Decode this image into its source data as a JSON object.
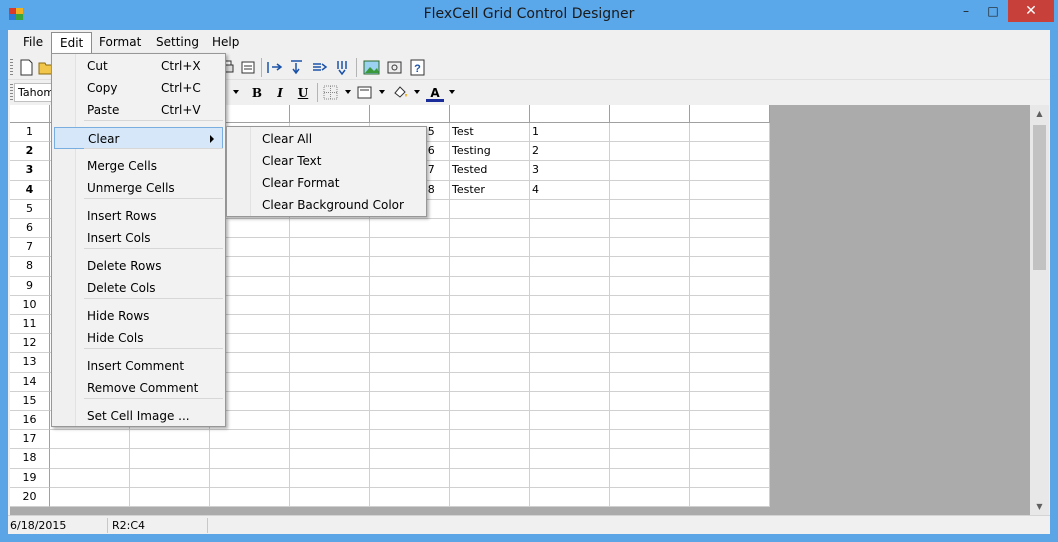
{
  "window": {
    "title": "FlexCell Grid Control Designer",
    "minimize": "–",
    "maximize": "□",
    "close": "✕"
  },
  "menubar": [
    "File",
    "Edit",
    "Format",
    "Setting",
    "Help"
  ],
  "toolbar": {
    "font": "Tahoma",
    "bold": "B",
    "italic": "I",
    "underline": "U",
    "font_color_glyph": "A"
  },
  "edit_menu": {
    "items": [
      {
        "label": "Cut",
        "shortcut": "Ctrl+X"
      },
      {
        "label": "Copy",
        "shortcut": "Ctrl+C"
      },
      {
        "label": "Paste",
        "shortcut": "Ctrl+V"
      },
      {
        "label": "Clear",
        "shortcut": ""
      },
      {
        "label": "Merge Cells",
        "shortcut": ""
      },
      {
        "label": "Unmerge Cells",
        "shortcut": ""
      },
      {
        "label": "Insert Rows",
        "shortcut": ""
      },
      {
        "label": "Insert Cols",
        "shortcut": ""
      },
      {
        "label": "Delete Rows",
        "shortcut": ""
      },
      {
        "label": "Delete Cols",
        "shortcut": ""
      },
      {
        "label": "Hide Rows",
        "shortcut": ""
      },
      {
        "label": "Hide Cols",
        "shortcut": ""
      },
      {
        "label": "Insert Comment",
        "shortcut": ""
      },
      {
        "label": "Remove Comment",
        "shortcut": ""
      },
      {
        "label": "Set Cell Image ...",
        "shortcut": ""
      }
    ]
  },
  "clear_submenu": [
    "Clear All",
    "Clear Text",
    "Clear Format",
    "Clear Background Color"
  ],
  "grid": {
    "row_numbers": [
      "1",
      "2",
      "3",
      "4",
      "5",
      "6",
      "7",
      "8",
      "9",
      "10",
      "11",
      "12",
      "13",
      "14",
      "15",
      "16",
      "17",
      "18",
      "19",
      "20"
    ],
    "bold_rows": [
      "2",
      "3",
      "4"
    ],
    "visible_cells": [
      [
        "Softpedia 5",
        "Test",
        "1"
      ],
      [
        "Softpedia 6",
        "Testing",
        "2"
      ],
      [
        "Softpedia 7",
        "Tested",
        "3"
      ],
      [
        "Softpedia 8",
        "Tester",
        "4"
      ]
    ]
  },
  "statusbar": {
    "date": "6/18/2015",
    "cell": "R2:C4"
  }
}
